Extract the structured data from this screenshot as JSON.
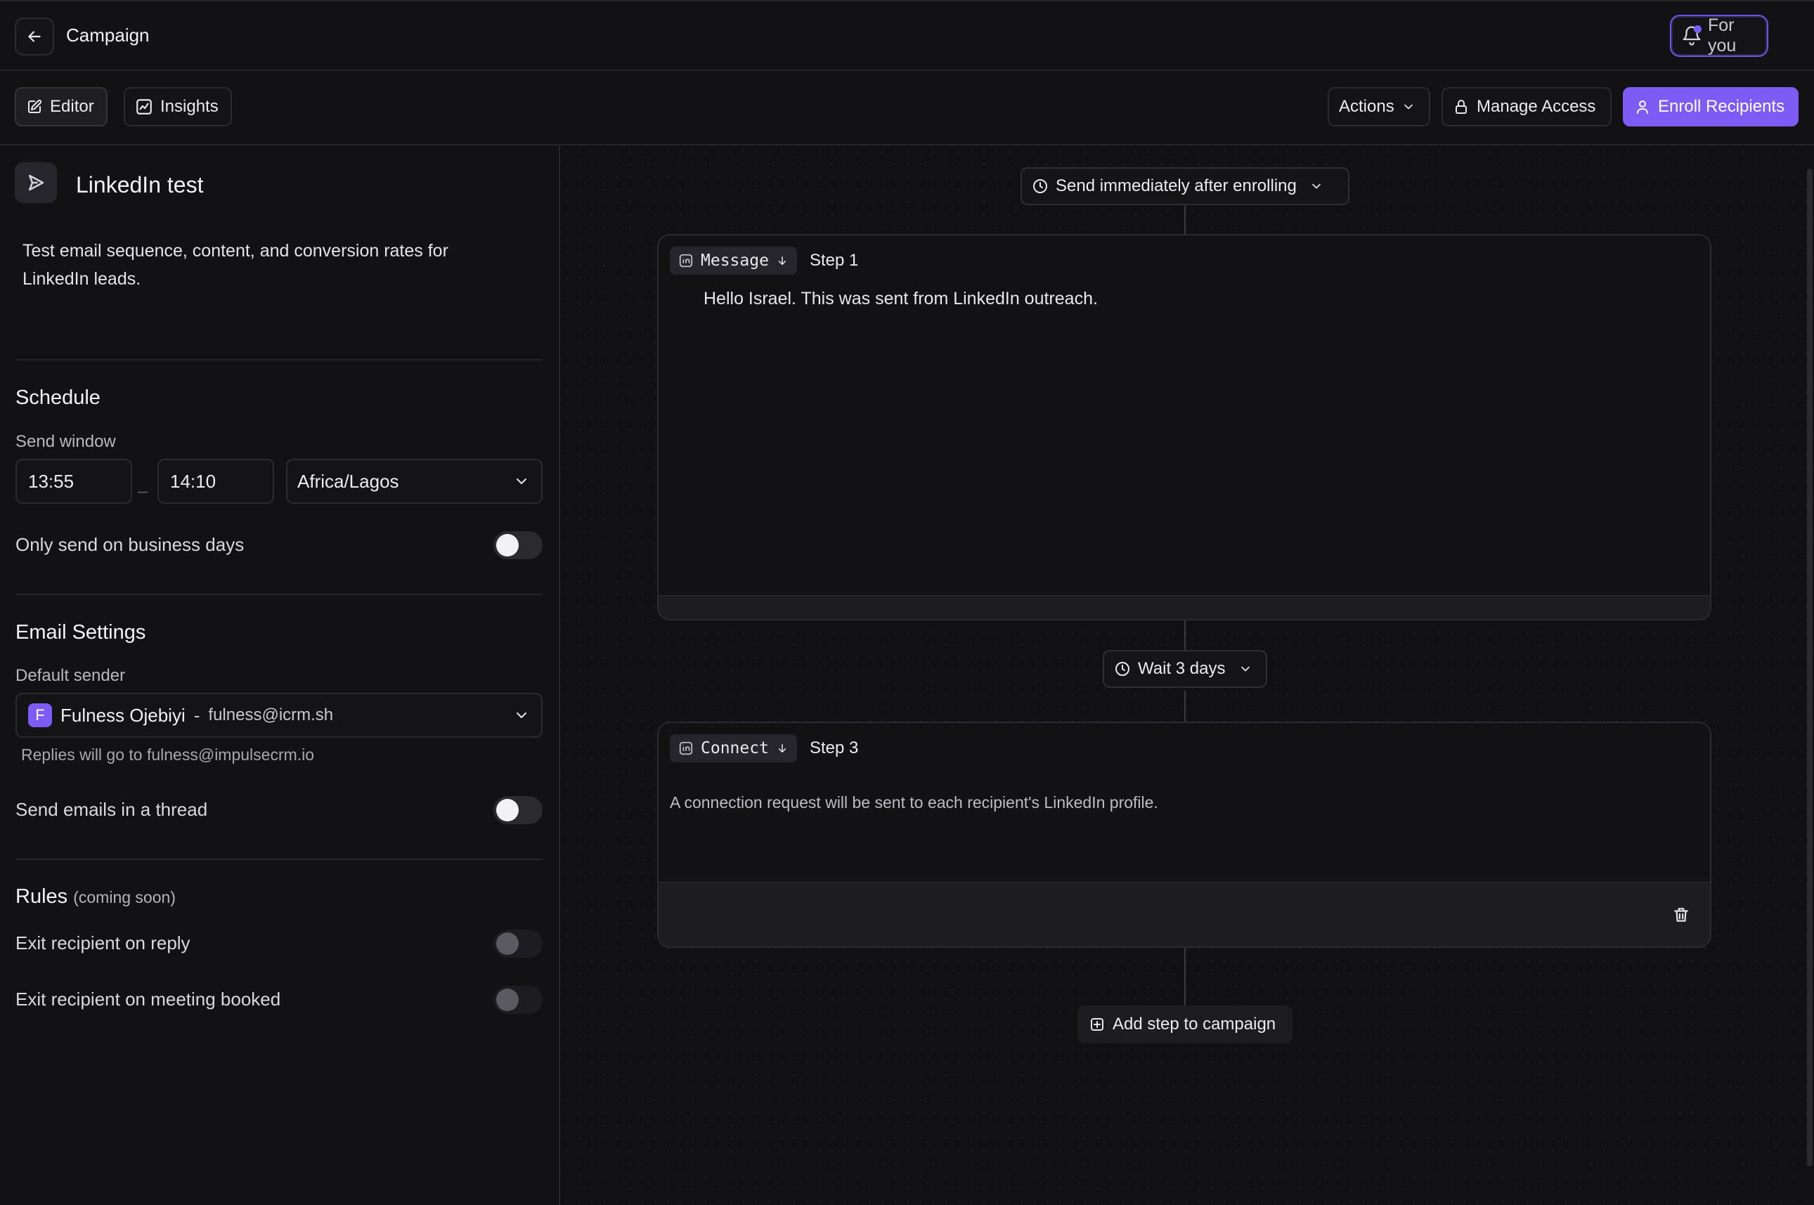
{
  "header": {
    "title": "Campaign",
    "notifications_label": "For you"
  },
  "toolbar": {
    "editor_label": "Editor",
    "insights_label": "Insights",
    "actions_label": "Actions",
    "manage_access_label": "Manage Access",
    "enroll_label": "Enroll Recipients"
  },
  "campaign": {
    "name": "LinkedIn test",
    "description": "Test email sequence, content, and conversion rates for LinkedIn leads."
  },
  "schedule": {
    "title": "Schedule",
    "send_window_label": "Send window",
    "start_time": "13:55",
    "separator": "–",
    "end_time": "14:10",
    "timezone": "Africa/Lagos",
    "business_days_label": "Only send on business days",
    "business_days_on": false
  },
  "email_settings": {
    "title": "Email Settings",
    "default_sender_label": "Default sender",
    "sender_initial": "F",
    "sender_name": "Fulness Ojebiyi",
    "sender_separator": "-",
    "sender_email": "fulness@icrm.sh",
    "reply_note": "Replies will go to fulness@impulsecrm.io",
    "thread_label": "Send emails in a thread",
    "thread_on": false
  },
  "rules": {
    "title": "Rules",
    "subtitle": "(coming soon)",
    "exit_on_reply_label": "Exit recipient on reply",
    "exit_on_meeting_label": "Exit recipient on meeting booked"
  },
  "flow": {
    "trigger_label": "Send immediately after enrolling",
    "step1": {
      "type_label": "Message",
      "step_label": "Step 1",
      "body": "Hello Israel. This was sent from LinkedIn outreach."
    },
    "wait_label": "Wait 3 days",
    "step3": {
      "type_label": "Connect",
      "step_label": "Step 3",
      "body": "A connection request will be sent to each recipient's LinkedIn profile."
    },
    "add_step_label": "Add step to campaign"
  },
  "colors": {
    "accent": "#7c5cf5",
    "background": "#111113",
    "panel": "#121214",
    "border": "#2b2b30"
  }
}
